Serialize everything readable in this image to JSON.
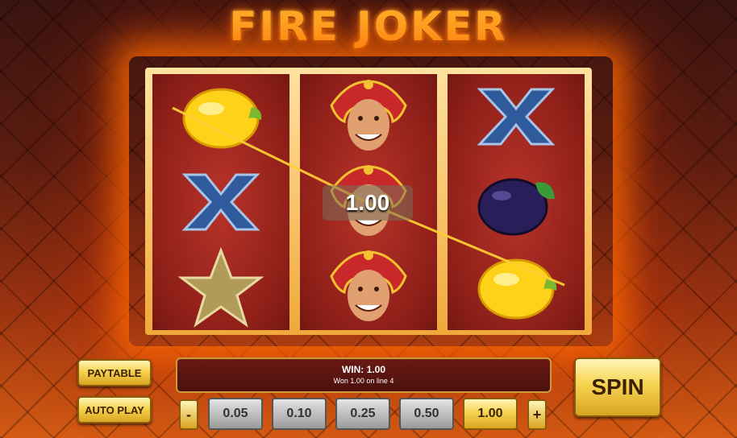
{
  "title": "FIRE JOKER",
  "reels": [
    [
      "lemon-icon",
      "x-icon",
      "star-icon"
    ],
    [
      "joker-icon",
      "joker-icon",
      "joker-icon"
    ],
    [
      "x-icon",
      "plum-icon",
      "lemon-icon"
    ]
  ],
  "win_amount": "1.00",
  "message": {
    "win_line": "WIN:  1.00",
    "detail": "Won 1.00 on line 4"
  },
  "buttons": {
    "paytable": "PAYTABLE",
    "autoplay": "AUTO PLAY",
    "spin": "SPIN",
    "decrease": "-",
    "increase": "+"
  },
  "bets": [
    "0.05",
    "0.10",
    "0.25",
    "0.50",
    "1.00"
  ],
  "selected_bet": "1.00",
  "colors": {
    "title": "#ffb62a",
    "reel": "#8d1f18",
    "gold": "#f6d350",
    "winline": "#ffcc33"
  }
}
